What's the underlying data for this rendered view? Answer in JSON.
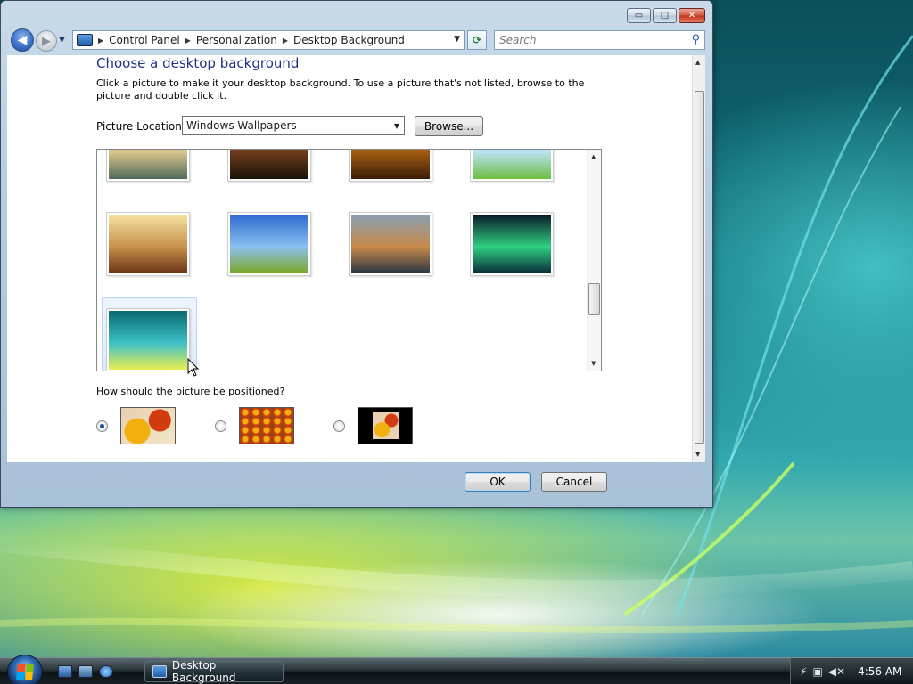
{
  "window": {
    "title": "Desktop Background",
    "caption_buttons": {
      "minimize": "▭",
      "maximize": "□",
      "close": "✕"
    }
  },
  "navigation": {
    "back_glyph": "◀",
    "forward_glyph": "▶",
    "breadcrumbs": [
      "Control Panel",
      "Personalization",
      "Desktop Background"
    ],
    "refresh_glyph": "⟳",
    "search_placeholder": "Search"
  },
  "page": {
    "heading": "Choose a desktop background",
    "instructions": "Click a picture to make it your desktop background. To use a picture that's not listed, browse to the picture and double click it.",
    "location_label": "Picture Location",
    "location_value": "Windows Wallpapers",
    "browse_label": "Browse...",
    "position_question": "How should the picture be positioned?",
    "position_selected": "fit-to-screen",
    "ok_label": "OK",
    "cancel_label": "Cancel"
  },
  "gallery": {
    "wallpapers": [
      {
        "name": "wallpaper-lake",
        "colors": [
          "#9fb7c6",
          "#d8c28c",
          "#4f6b5a"
        ]
      },
      {
        "name": "wallpaper-sunset-hills",
        "colors": [
          "#e3a43a",
          "#6a3a1a",
          "#1b1208"
        ]
      },
      {
        "name": "wallpaper-golden-water",
        "colors": [
          "#f0c060",
          "#a05a10",
          "#3a1c08"
        ]
      },
      {
        "name": "wallpaper-beach-palm",
        "colors": [
          "#7fc5e8",
          "#b8e0ef",
          "#6cbf40"
        ]
      },
      {
        "name": "wallpaper-grass-sunrise",
        "colors": [
          "#f7e2a0",
          "#c6904a",
          "#6a3416"
        ]
      },
      {
        "name": "wallpaper-green-hills",
        "colors": [
          "#2f6ad0",
          "#8bc0f0",
          "#7aa824"
        ]
      },
      {
        "name": "wallpaper-mountain-lake",
        "colors": [
          "#8aa0b2",
          "#c8894a",
          "#2a3440"
        ]
      },
      {
        "name": "wallpaper-aurora",
        "colors": [
          "#0a1a2a",
          "#2fd080",
          "#0a2a3a"
        ]
      },
      {
        "name": "wallpaper-vista-aurora",
        "colors": [
          "#0a6a70",
          "#3ec0c8",
          "#e8ee50"
        ]
      }
    ]
  },
  "taskbar": {
    "active_task": "Desktop Background",
    "clock": "4:56 AM",
    "tray_icons": [
      "network-icon",
      "network-disconnected-icon",
      "volume-muted-icon"
    ]
  },
  "colors": {
    "accent": "#1e3287",
    "title_bar": "#b7cce0",
    "close_button": "#c0341b"
  }
}
